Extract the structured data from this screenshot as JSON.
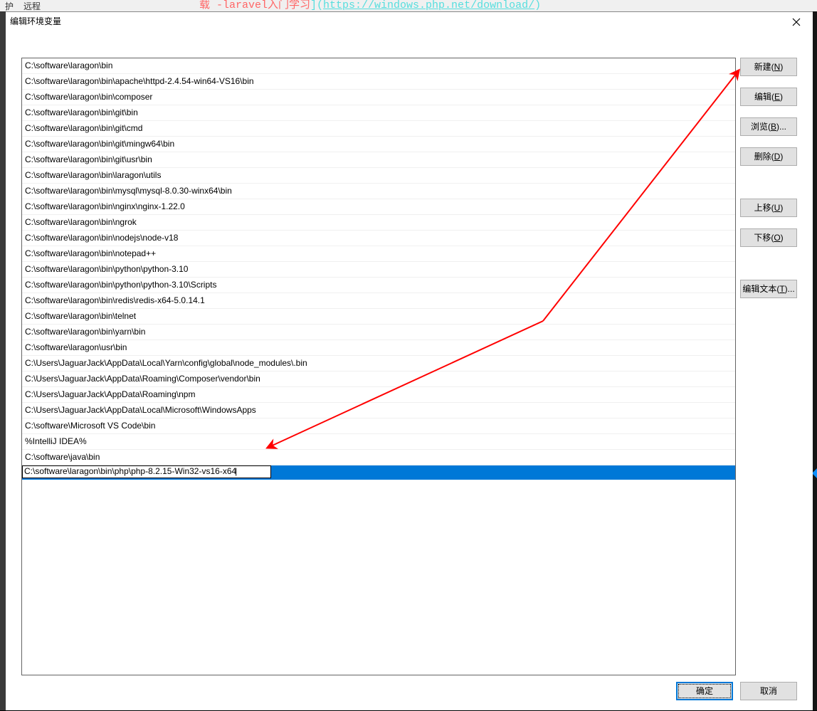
{
  "bg": {
    "menu": [
      "护",
      "远程"
    ],
    "url_left": "载 -laravel入门学习",
    "url_mid": "](",
    "url_link": "https://windows.php.net/download/",
    "url_right": ")"
  },
  "dialog": {
    "title": "编辑环境变量"
  },
  "paths": [
    "C:\\software\\laragon\\bin",
    "C:\\software\\laragon\\bin\\apache\\httpd-2.4.54-win64-VS16\\bin",
    "C:\\software\\laragon\\bin\\composer",
    "C:\\software\\laragon\\bin\\git\\bin",
    "C:\\software\\laragon\\bin\\git\\cmd",
    "C:\\software\\laragon\\bin\\git\\mingw64\\bin",
    "C:\\software\\laragon\\bin\\git\\usr\\bin",
    "C:\\software\\laragon\\bin\\laragon\\utils",
    "C:\\software\\laragon\\bin\\mysql\\mysql-8.0.30-winx64\\bin",
    "C:\\software\\laragon\\bin\\nginx\\nginx-1.22.0",
    "C:\\software\\laragon\\bin\\ngrok",
    "C:\\software\\laragon\\bin\\nodejs\\node-v18",
    "C:\\software\\laragon\\bin\\notepad++",
    "C:\\software\\laragon\\bin\\python\\python-3.10",
    "C:\\software\\laragon\\bin\\python\\python-3.10\\Scripts",
    "C:\\software\\laragon\\bin\\redis\\redis-x64-5.0.14.1",
    "C:\\software\\laragon\\bin\\telnet",
    "C:\\software\\laragon\\bin\\yarn\\bin",
    "C:\\software\\laragon\\usr\\bin",
    "C:\\Users\\JaguarJack\\AppData\\Local\\Yarn\\config\\global\\node_modules\\.bin",
    "C:\\Users\\JaguarJack\\AppData\\Roaming\\Composer\\vendor\\bin",
    "C:\\Users\\JaguarJack\\AppData\\Roaming\\npm",
    "C:\\Users\\JaguarJack\\AppData\\Local\\Microsoft\\WindowsApps",
    "C:\\software\\Microsoft VS Code\\bin",
    "%IntelliJ IDEA%",
    "C:\\software\\java\\bin"
  ],
  "edit_value": "C:\\software\\laragon\\bin\\php\\php-8.2.15-Win32-vs16-x64",
  "buttons": {
    "new": "新建(N)",
    "edit": "编辑(E)",
    "browse": "浏览(B)...",
    "delete": "删除(D)",
    "moveup": "上移(U)",
    "movedown": "下移(O)",
    "edittext": "编辑文本(T)...",
    "ok": "确定",
    "cancel": "取消"
  }
}
